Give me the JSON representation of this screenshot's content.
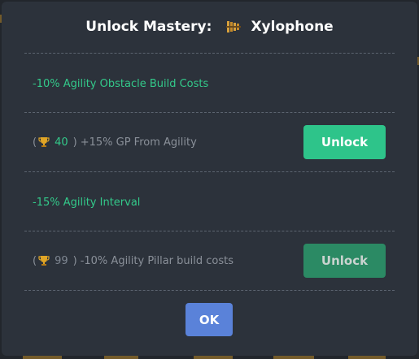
{
  "dialog": {
    "title_prefix": "Unlock Mastery:",
    "item_name": "Xylophone",
    "item_icon": "xylophone-icon"
  },
  "masteries": [
    {
      "bonus": "-10% Agility Obstacle Build Costs",
      "paren_open": "(",
      "cost": "40",
      "paren_close": ")",
      "unlock_bonus": "+15% GP From Agility",
      "button_label": "Unlock",
      "enabled": true
    },
    {
      "bonus": "-15% Agility Interval",
      "paren_open": "(",
      "cost": "99",
      "paren_close": ")",
      "unlock_bonus": "-10% Agility Pillar build costs",
      "button_label": "Unlock",
      "enabled": false
    }
  ],
  "footer": {
    "ok_label": "OK"
  },
  "colors": {
    "accent_green": "#2ec48a",
    "ok_blue": "#5a82d9",
    "panel": "#2c323b"
  }
}
